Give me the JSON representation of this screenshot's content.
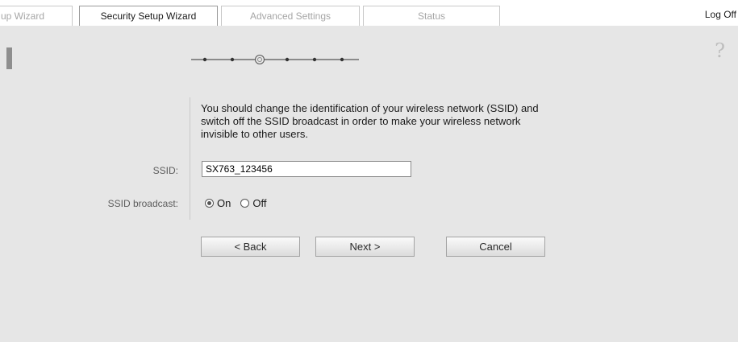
{
  "tabs": [
    {
      "label": "up Wizard",
      "active": false
    },
    {
      "label": "Security Setup Wizard",
      "active": true
    },
    {
      "label": "Advanced Settings",
      "active": false
    },
    {
      "label": "Status",
      "active": false
    }
  ],
  "header": {
    "logoff_label": "Log Off"
  },
  "help": {
    "icon": "question-mark-icon",
    "glyph": "?"
  },
  "wizard": {
    "total_steps": 6,
    "current_step": 3,
    "description": "You should change the identification of your wireless network (SSID) and switch off the SSID broadcast in order to make your wireless network invisible to other users."
  },
  "form": {
    "ssid_label": "SSID:",
    "ssid_value": "SX763_123456",
    "broadcast_label": "SSID broadcast:",
    "broadcast_options": [
      {
        "label": "On",
        "selected": true
      },
      {
        "label": "Off",
        "selected": false
      }
    ]
  },
  "buttons": {
    "back": "< Back",
    "next": "Next >",
    "cancel": "Cancel"
  },
  "colors": {
    "panel_bg": "#e6e6e6",
    "tab_border": "#c8c8c8",
    "text": "#1a1a1a"
  }
}
